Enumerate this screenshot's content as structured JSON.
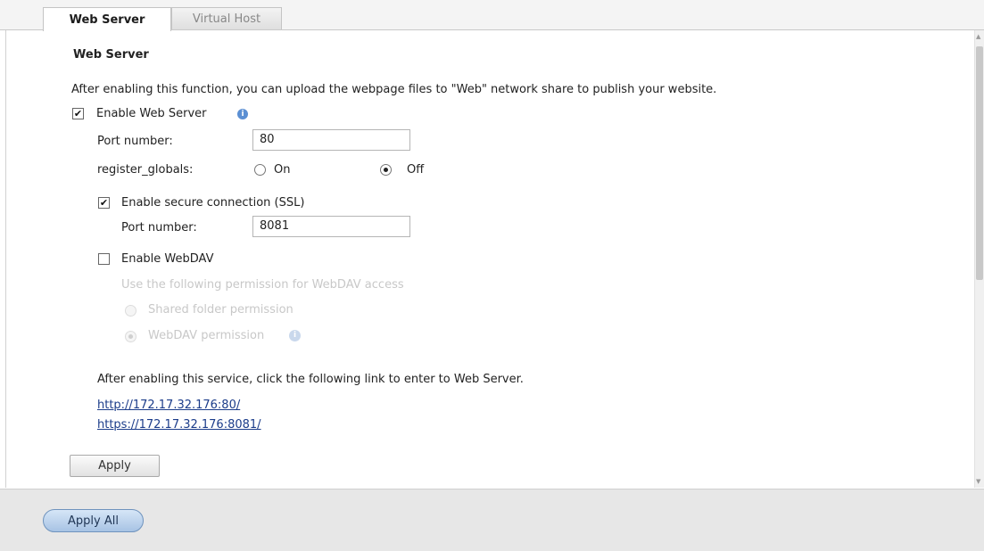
{
  "tabs": [
    {
      "label": "Web Server",
      "active": true
    },
    {
      "label": "Virtual Host",
      "active": false
    }
  ],
  "section": {
    "title": "Web Server",
    "description": "After enabling this function, you can upload the webpage files to \"Web\" network share to publish your website."
  },
  "web_server": {
    "enable_label": "Enable Web Server",
    "enabled": true,
    "port_label": "Port number:",
    "port_value": "80",
    "register_globals_label": "register_globals:",
    "on_label": "On",
    "off_label": "Off",
    "register_globals_value": "Off"
  },
  "ssl": {
    "enable_label": "Enable secure connection (SSL)",
    "enabled": true,
    "port_label": "Port number:",
    "port_value": "8081"
  },
  "webdav": {
    "enable_label": "Enable WebDAV",
    "enabled": false,
    "permission_hint": "Use the following permission for WebDAV access",
    "option_shared": "Shared folder permission",
    "option_webdav": "WebDAV permission",
    "selected": "WebDAV permission"
  },
  "links": {
    "intro": "After enabling this service, click the following link to enter to Web Server.",
    "http": "http://172.17.32.176:80/",
    "https": "https://172.17.32.176:8081/"
  },
  "buttons": {
    "apply": "Apply",
    "apply_all": "Apply All"
  },
  "colors": {
    "link": "#1b3c8a",
    "info_icon": "#5b8fd3",
    "apply_all_bg": "#a7c3e4"
  }
}
